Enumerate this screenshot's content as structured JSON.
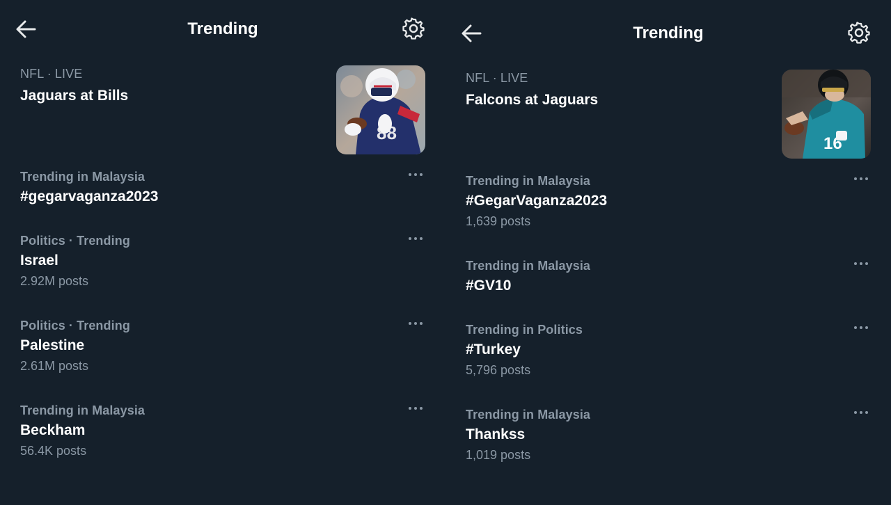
{
  "left": {
    "header": {
      "title": "Trending"
    },
    "live": {
      "meta": "NFL · LIVE",
      "name": "Jaguars at Bills"
    },
    "trends": [
      {
        "meta": "Trending in Malaysia",
        "name": "#gegarvaganza2023",
        "posts": ""
      },
      {
        "meta": "Politics · Trending",
        "name": "Israel",
        "posts": "2.92M posts"
      },
      {
        "meta": "Politics · Trending",
        "name": "Palestine",
        "posts": "2.61M posts"
      },
      {
        "meta": "Trending in Malaysia",
        "name": "Beckham",
        "posts": "56.4K posts"
      }
    ]
  },
  "right": {
    "header": {
      "title": "Trending"
    },
    "live": {
      "meta": "NFL · LIVE",
      "name": "Falcons at Jaguars"
    },
    "trends": [
      {
        "meta": "Trending in Malaysia",
        "name": "#GegarVaganza2023",
        "posts": "1,639 posts"
      },
      {
        "meta": "Trending in Malaysia",
        "name": "#GV10",
        "posts": ""
      },
      {
        "meta": "Trending in Politics",
        "name": "#Turkey",
        "posts": "5,796 posts"
      },
      {
        "meta": "Trending in Malaysia",
        "name": "Thankss",
        "posts": "1,019 posts"
      }
    ]
  },
  "icons": {
    "back": "arrow-left-icon",
    "settings": "gear-icon",
    "more": "more-horizontal-icon"
  },
  "colors": {
    "background": "#15202b",
    "text_primary": "#ffffff",
    "text_secondary": "#8b98a5"
  }
}
